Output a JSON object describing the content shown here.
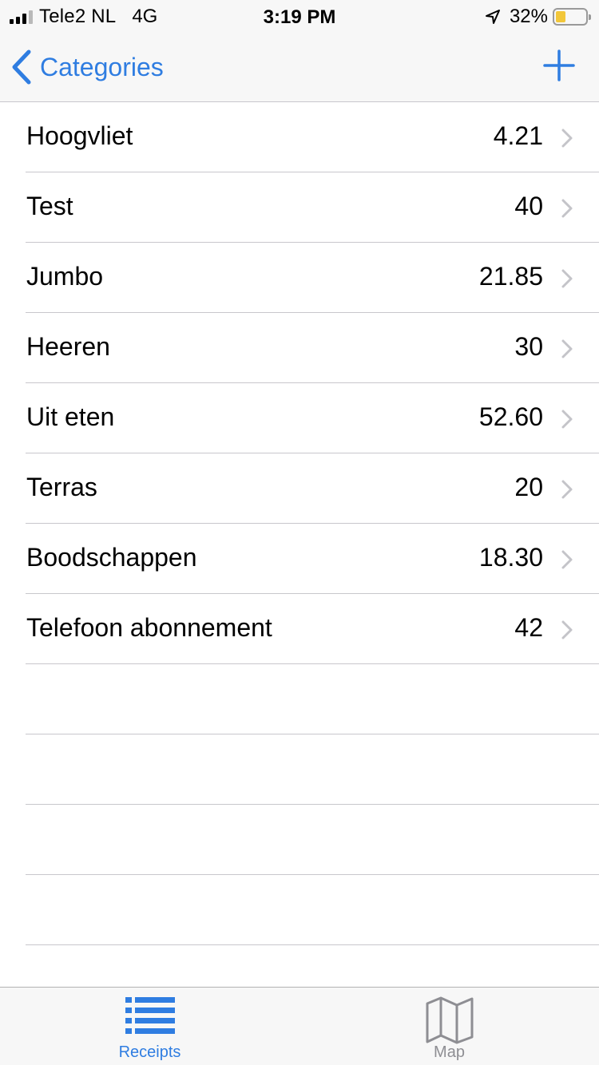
{
  "status_bar": {
    "carrier": "Tele2 NL",
    "network": "4G",
    "time": "3:19 PM",
    "battery_text": "32%",
    "battery_level": 0.32,
    "location_icon": "location-arrow-icon"
  },
  "nav": {
    "back_label": "Categories",
    "back_icon": "chevron-left-icon",
    "add_icon": "plus-icon"
  },
  "categories": [
    {
      "name": "Hoogvliet",
      "amount": "4.21"
    },
    {
      "name": "Test",
      "amount": "40"
    },
    {
      "name": "Jumbo",
      "amount": "21.85"
    },
    {
      "name": "Heeren",
      "amount": "30"
    },
    {
      "name": "Uit eten",
      "amount": "52.60"
    },
    {
      "name": "Terras",
      "amount": "20"
    },
    {
      "name": "Boodschappen",
      "amount": "18.30"
    },
    {
      "name": "Telefoon abonnement",
      "amount": "42"
    }
  ],
  "tab_bar": {
    "tabs": [
      {
        "label": "Receipts",
        "icon": "list-icon",
        "active": true
      },
      {
        "label": "Map",
        "icon": "map-icon",
        "active": false
      }
    ]
  },
  "colors": {
    "accent": "#2f7de1",
    "inactive": "#8e8e93",
    "separator": "#c8c7cc",
    "battery_fill": "#f2c73a"
  }
}
